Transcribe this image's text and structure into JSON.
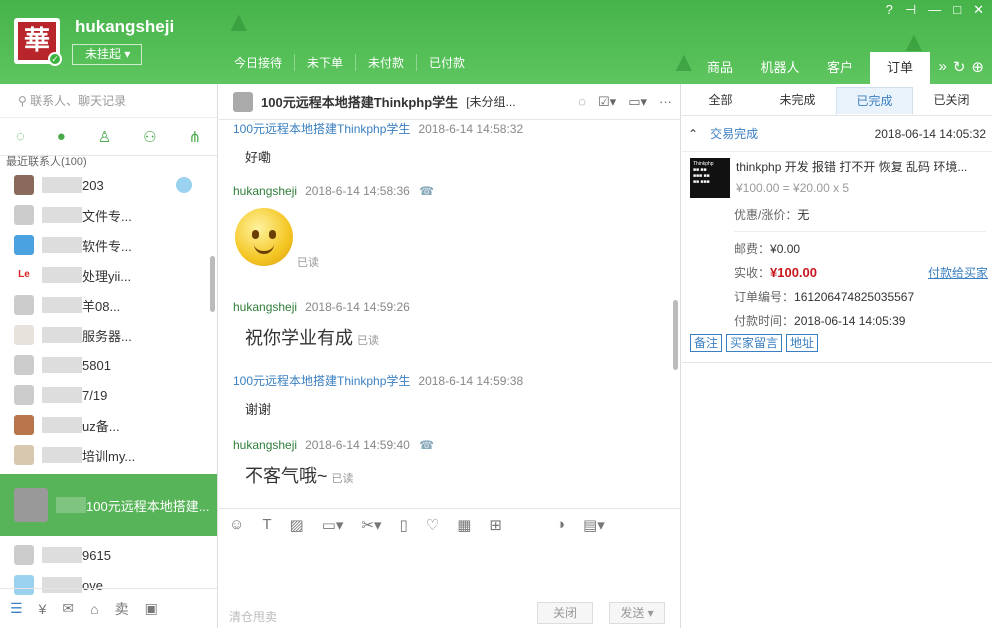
{
  "header": {
    "username": "hukangsheji",
    "avatar_char": "華",
    "status": "未挂起",
    "stats": [
      "今日接待",
      "未下单",
      "未付款",
      "已付款"
    ],
    "nav": [
      "商品",
      "机器人",
      "客户",
      "订单"
    ],
    "accent": "#52bd54"
  },
  "left": {
    "search_placeholder": "联系人、聊天记录",
    "group_label": "最近联系人(100)",
    "contacts": [
      {
        "name": "203"
      },
      {
        "name": "文件专..."
      },
      {
        "name": "软件专..."
      },
      {
        "name": "处理yii..."
      },
      {
        "name": "羊08..."
      },
      {
        "name": "服务器..."
      },
      {
        "name": "5801"
      },
      {
        "name": "7/19"
      },
      {
        "name": "uz备..."
      },
      {
        "name": "培训my..."
      },
      {
        "name": "100元远程本地搭建..."
      },
      {
        "name": "9615"
      },
      {
        "name": "ove"
      }
    ]
  },
  "chat": {
    "title": "100元远程本地搭建Thinkphp学生",
    "subtitle": "[未分组...",
    "messages": [
      {
        "who": "100元远程本地搭建Thinkphp学生",
        "time": "2018-6-14 14:58:32",
        "text": "好嘞"
      },
      {
        "who": "hukangsheji",
        "time": "2018-6-14 14:58:36",
        "text": "",
        "read": "已读"
      },
      {
        "who": "hukangsheji",
        "time": "2018-6-14 14:59:26",
        "text": "祝你学业有成",
        "read": "已读"
      },
      {
        "who": "100元远程本地搭建Thinkphp学生",
        "time": "2018-6-14 14:59:38",
        "text": "谢谢"
      },
      {
        "who": "hukangsheji",
        "time": "2018-6-14 14:59:40",
        "text": "不客气哦~",
        "read": "已读"
      }
    ],
    "input_placeholder": "清仓甩卖",
    "close_label": "关闭",
    "send_label": "发送"
  },
  "order": {
    "tabs": [
      "全部",
      "未完成",
      "已完成",
      "已关闭"
    ],
    "status": "交易完成",
    "date": "2018-06-14 14:05:32",
    "product_title": "thinkphp 开发 报错 打不开 恢复 乱码 环境...",
    "price_line": "¥100.00 = ¥20.00 x 5",
    "discount_label": "优惠/涨价：",
    "discount_value": "无",
    "postage_label": "邮费：",
    "postage": "¥0.00",
    "paid_label": "实收：",
    "paid": "¥100.00",
    "pay_link": "付款给买家",
    "order_no_label": "订单编号：",
    "order_no": "161206474825035567",
    "pay_time_label": "付款时间：",
    "pay_time": "2018-06-14 14:05:39",
    "tags": [
      "备注",
      "买家留言",
      "地址"
    ]
  }
}
